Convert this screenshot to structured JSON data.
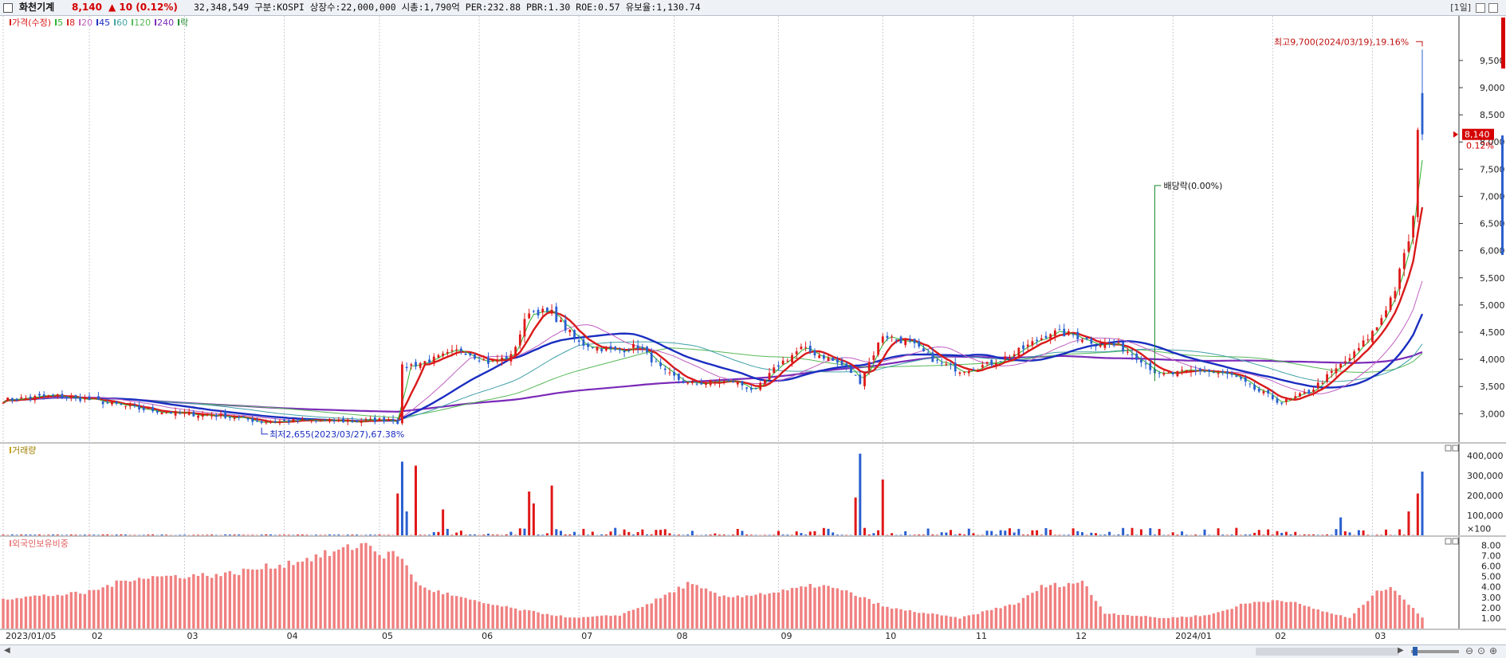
{
  "header": {
    "name": "화천기계",
    "price": "8,140",
    "change": "▲ 10 (0.12%)",
    "info": "32,348,549  구분:KOSPI 상장수:22,000,000 시총:1,790억 PER:232.88 PBR:1.30 ROE:0.57 유보율:1,130.74",
    "period": "[1일]"
  },
  "colors": {
    "up": "#e01818",
    "down": "#2a5fd0",
    "ma5": "#2ab02a",
    "ma8": "#d91a1a",
    "ma20": "#c060c0",
    "ma45": "#1a2ec0",
    "ma60": "#40a0a8",
    "ma120": "#58b858",
    "ma240": "#7a2ab8",
    "dividend": "#1b8a2e",
    "foreign": "#f08080"
  },
  "chart_data": [
    {
      "type": "candlestick",
      "legend": [
        {
          "label": "가격(수정)",
          "color": "#d91a1a"
        },
        {
          "label": "5",
          "color": "#2ab02a"
        },
        {
          "label": "8",
          "color": "#d91a1a"
        },
        {
          "label": "20",
          "color": "#c060c0"
        },
        {
          "label": "45",
          "color": "#1a2ec0"
        },
        {
          "label": "60",
          "color": "#40a0a8"
        },
        {
          "label": "120",
          "color": "#58b858"
        },
        {
          "label": "240",
          "color": "#7a2ab8"
        },
        {
          "label": "락",
          "color": "#1b8a2e"
        }
      ],
      "y_ticks": [
        3000,
        3500,
        4000,
        4500,
        5000,
        5500,
        6000,
        6500,
        7000,
        7500,
        8000,
        8500,
        9000,
        9500
      ],
      "y_tick_labels": [
        "3,000",
        "3,500",
        "4,000",
        "4,500",
        "5,000",
        "5,500",
        "6,000",
        "6,500",
        "7,000",
        "7,500",
        "8,000",
        "8,500",
        "9,000",
        "9,500"
      ],
      "ylim": [
        2550,
        10320
      ],
      "x_ticks": [
        {
          "label": "2023/01/05",
          "date": "2023-01-05"
        },
        {
          "label": "02",
          "date": "2023-02-01"
        },
        {
          "label": "03",
          "date": "2023-03-02"
        },
        {
          "label": "04",
          "date": "2023-04-03"
        },
        {
          "label": "05",
          "date": "2023-05-02"
        },
        {
          "label": "06",
          "date": "2023-06-01"
        },
        {
          "label": "07",
          "date": "2023-07-03"
        },
        {
          "label": "08",
          "date": "2023-08-01"
        },
        {
          "label": "09",
          "date": "2023-09-01"
        },
        {
          "label": "10",
          "date": "2023-10-04"
        },
        {
          "label": "11",
          "date": "2023-11-01"
        },
        {
          "label": "12",
          "date": "2023-12-01"
        },
        {
          "label": "2024/01",
          "date": "2024-01-02"
        },
        {
          "label": "02",
          "date": "2024-02-01"
        },
        {
          "label": "03",
          "date": "2024-03-04"
        }
      ],
      "close_path": [
        [
          "2023-01-05",
          3250
        ],
        [
          "2023-01-20",
          3330
        ],
        [
          "2023-02-01",
          3260
        ],
        [
          "2023-02-15",
          3100
        ],
        [
          "2023-03-01",
          3000
        ],
        [
          "2023-03-15",
          2960
        ],
        [
          "2023-03-27",
          2850
        ],
        [
          "2023-04-10",
          2870
        ],
        [
          "2023-04-25",
          2860
        ],
        [
          "2023-05-05",
          2900
        ],
        [
          "2023-05-08",
          2850
        ],
        [
          "2023-05-09",
          3850
        ],
        [
          "2023-05-18",
          4000
        ],
        [
          "2023-05-26",
          4180
        ],
        [
          "2023-06-05",
          3950
        ],
        [
          "2023-06-12",
          4050
        ],
        [
          "2023-06-16",
          4900
        ],
        [
          "2023-06-23",
          4850
        ],
        [
          "2023-07-03",
          4300
        ],
        [
          "2023-07-13",
          4150
        ],
        [
          "2023-07-20",
          4250
        ],
        [
          "2023-07-28",
          3750
        ],
        [
          "2023-08-04",
          3550
        ],
        [
          "2023-08-18",
          3600
        ],
        [
          "2023-08-25",
          3420
        ],
        [
          "2023-09-01",
          3900
        ],
        [
          "2023-09-08",
          4200
        ],
        [
          "2023-09-15",
          4050
        ],
        [
          "2023-09-22",
          3850
        ],
        [
          "2023-09-27",
          3600
        ],
        [
          "2023-10-04",
          4450
        ],
        [
          "2023-10-12",
          4300
        ],
        [
          "2023-10-20",
          3950
        ],
        [
          "2023-10-27",
          3800
        ],
        [
          "2023-11-06",
          3900
        ],
        [
          "2023-11-14",
          4100
        ],
        [
          "2023-11-24",
          4500
        ],
        [
          "2023-12-01",
          4450
        ],
        [
          "2023-12-08",
          4300
        ],
        [
          "2023-12-15",
          4250
        ],
        [
          "2023-12-22",
          4000
        ],
        [
          "2023-12-28",
          3700
        ],
        [
          "2024-01-10",
          3800
        ],
        [
          "2024-01-19",
          3700
        ],
        [
          "2024-01-26",
          3450
        ],
        [
          "2024-02-05",
          3200
        ],
        [
          "2024-02-13",
          3400
        ],
        [
          "2024-02-20",
          3750
        ],
        [
          "2024-02-27",
          4100
        ],
        [
          "2024-03-05",
          4600
        ],
        [
          "2024-03-11",
          5300
        ],
        [
          "2024-03-14",
          6200
        ],
        [
          "2024-03-15",
          6600
        ],
        [
          "2024-03-18",
          8130
        ],
        [
          "2024-03-19",
          8140
        ]
      ],
      "annotations": [
        {
          "text": "최고9,700(2024/03/19),19.16%",
          "date": "2024-03-19",
          "value": 9700
        },
        {
          "text": "최저2,655(2023/03/27),67.38%",
          "date": "2023-03-27",
          "value": 2655
        },
        {
          "text": "배당락(0.00%)",
          "date": "2023-12-27"
        }
      ],
      "current_price_label": "8,140",
      "current_change_label": "0.12%"
    },
    {
      "type": "bar",
      "title": "거래량",
      "y_ticks": [
        100000,
        200000,
        300000,
        400000
      ],
      "y_tick_labels": [
        "×100",
        "100,000",
        "200,000",
        "300,000",
        "400,000"
      ],
      "ylim": [
        0,
        420000
      ],
      "spikes": [
        {
          "date": "2023-05-08",
          "value": 210000,
          "up": true
        },
        {
          "date": "2023-05-09",
          "value": 370000,
          "up": false
        },
        {
          "date": "2023-05-10",
          "value": 120000,
          "up": false
        },
        {
          "date": "2023-05-12",
          "value": 350000,
          "up": true
        },
        {
          "date": "2023-05-22",
          "value": 130000,
          "up": true
        },
        {
          "date": "2023-06-16",
          "value": 220000,
          "up": true
        },
        {
          "date": "2023-06-19",
          "value": 160000,
          "up": true
        },
        {
          "date": "2023-06-23",
          "value": 250000,
          "up": true
        },
        {
          "date": "2023-09-26",
          "value": 190000,
          "up": true
        },
        {
          "date": "2023-09-27",
          "value": 410000,
          "up": false
        },
        {
          "date": "2023-10-04",
          "value": 280000,
          "up": true
        },
        {
          "date": "2024-02-22",
          "value": 90000,
          "up": false
        },
        {
          "date": "2024-03-14",
          "value": 120000,
          "up": true
        },
        {
          "date": "2024-03-18",
          "value": 210000,
          "up": true
        },
        {
          "date": "2024-03-19",
          "value": 320000,
          "up": false
        }
      ]
    },
    {
      "type": "bar",
      "title": "외국인보유비중",
      "y_ticks": [
        1,
        2,
        3,
        4,
        5,
        6,
        7,
        8
      ],
      "y_tick_labels": [
        "1.00",
        "2.00",
        "3.00",
        "4.00",
        "5.00",
        "6.00",
        "7.00",
        "8.00"
      ],
      "ylim": [
        0,
        8.8
      ],
      "profile": [
        [
          "2023-01-05",
          2.9
        ],
        [
          "2023-01-31",
          3.4
        ],
        [
          "2023-02-15",
          4.9
        ],
        [
          "2023-03-15",
          5.2
        ],
        [
          "2023-04-03",
          6.2
        ],
        [
          "2023-04-17",
          7.2
        ],
        [
          "2023-04-27",
          8.2
        ],
        [
          "2023-05-03",
          7.0
        ],
        [
          "2023-05-08",
          7.2
        ],
        [
          "2023-05-15",
          4.0
        ],
        [
          "2023-05-31",
          2.6
        ],
        [
          "2023-06-14",
          1.8
        ],
        [
          "2023-06-30",
          1.0
        ],
        [
          "2023-07-14",
          1.3
        ],
        [
          "2023-07-25",
          2.5
        ],
        [
          "2023-08-04",
          4.3
        ],
        [
          "2023-08-16",
          3.0
        ],
        [
          "2023-09-01",
          3.5
        ],
        [
          "2023-09-14",
          4.2
        ],
        [
          "2023-09-25",
          3.4
        ],
        [
          "2023-10-05",
          2.0
        ],
        [
          "2023-10-27",
          1.0
        ],
        [
          "2023-11-15",
          2.5
        ],
        [
          "2023-11-22",
          4.0
        ],
        [
          "2023-12-05",
          4.5
        ],
        [
          "2023-12-12",
          1.5
        ],
        [
          "2023-12-29",
          1.0
        ],
        [
          "2024-01-12",
          1.3
        ],
        [
          "2024-01-24",
          2.4
        ],
        [
          "2024-02-05",
          2.8
        ],
        [
          "2024-02-15",
          1.8
        ],
        [
          "2024-02-26",
          1.0
        ],
        [
          "2024-03-04",
          3.2
        ],
        [
          "2024-03-08",
          4.2
        ],
        [
          "2024-03-13",
          2.8
        ],
        [
          "2024-03-19",
          1.0
        ]
      ]
    }
  ]
}
